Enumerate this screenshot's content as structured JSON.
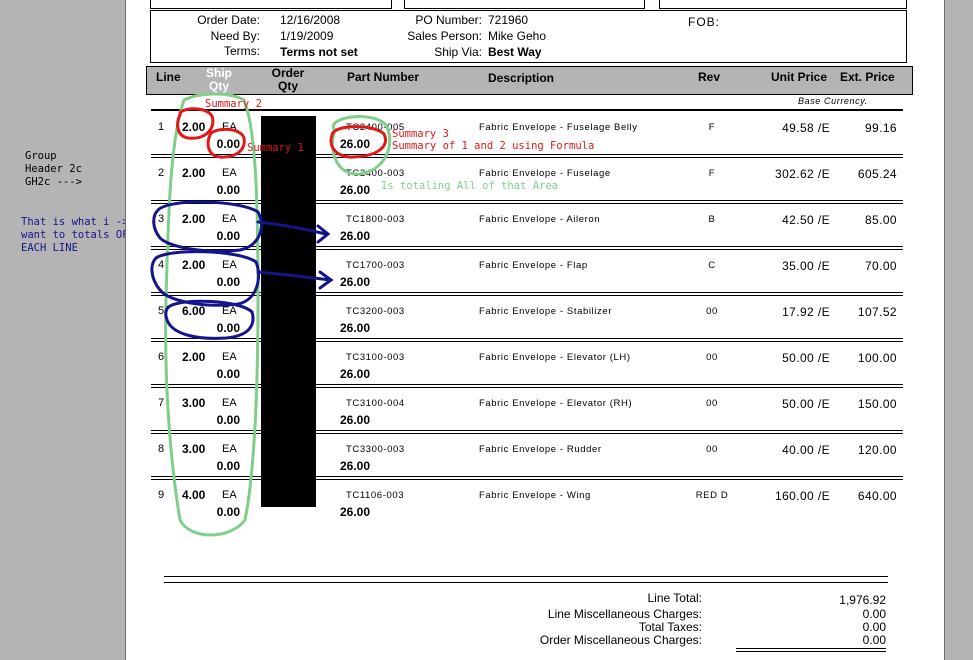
{
  "header": {
    "order_date_label": "Order Date:",
    "order_date": "12/16/2008",
    "need_by_label": "Need By:",
    "need_by": "1/19/2009",
    "terms_label": "Terms:",
    "terms": "Terms not set",
    "po_label": "PO Number:",
    "po": "721960",
    "sales_label": "Sales Person:",
    "sales": "Mike Geho",
    "shipvia_label": "Ship Via:",
    "shipvia": "Best Way",
    "fob_label": "FOB:"
  },
  "columns": {
    "line": "Line",
    "ship": "Ship",
    "ship2": "Qty",
    "order": "Order",
    "order2": "Qty",
    "part": "Part Number",
    "desc": "Description",
    "rev": "Rev",
    "unit": "Unit Price",
    "ext": "Ext. Price"
  },
  "base_currency": "Base Currency.",
  "rows": [
    {
      "line": "1",
      "ship": "2.00",
      "uom": "EA",
      "sub": "0.00",
      "part": "TC2400-005",
      "sum": "26.00",
      "desc": "Fabric Envelope - Fuselage Belly",
      "rev": "F",
      "unit": "49.58 /E",
      "ext": "99.16"
    },
    {
      "line": "2",
      "ship": "2.00",
      "uom": "EA",
      "sub": "0.00",
      "part": "TC2400-003",
      "sum": "26.00",
      "desc": "Fabric Envelope - Fuselage",
      "rev": "F",
      "unit": "302.62 /E",
      "ext": "605.24"
    },
    {
      "line": "3",
      "ship": "2.00",
      "uom": "EA",
      "sub": "0.00",
      "part": "TC1800-003",
      "sum": "26.00",
      "desc": "Fabric Envelope - Aileron",
      "rev": "B",
      "unit": "42.50 /E",
      "ext": "85.00"
    },
    {
      "line": "4",
      "ship": "2.00",
      "uom": "EA",
      "sub": "0.00",
      "part": "TC1700-003",
      "sum": "26.00",
      "desc": "Fabric Envelope - Flap",
      "rev": "C",
      "unit": "35.00 /E",
      "ext": "70.00"
    },
    {
      "line": "5",
      "ship": "6.00",
      "uom": "EA",
      "sub": "0.00",
      "part": "TC3200-003",
      "sum": "26.00",
      "desc": "Fabric Envelope - Stabilizer",
      "rev": "00",
      "unit": "17.92 /E",
      "ext": "107.52"
    },
    {
      "line": "6",
      "ship": "2.00",
      "uom": "EA",
      "sub": "0.00",
      "part": "TC3100-003",
      "sum": "26.00",
      "desc": "Fabric Envelope - Elevator (LH)",
      "rev": "00",
      "unit": "50.00 /E",
      "ext": "100.00"
    },
    {
      "line": "7",
      "ship": "3.00",
      "uom": "EA",
      "sub": "0.00",
      "part": "TC3100-004",
      "sum": "26.00",
      "desc": "Fabric Envelope - Elevator (RH)",
      "rev": "00",
      "unit": "50.00 /E",
      "ext": "150.00"
    },
    {
      "line": "8",
      "ship": "3.00",
      "uom": "EA",
      "sub": "0.00",
      "part": "TC3300-003",
      "sum": "26.00",
      "desc": "Fabric Envelope - Rudder",
      "rev": "00",
      "unit": "40.00 /E",
      "ext": "120.00"
    },
    {
      "line": "9",
      "ship": "4.00",
      "uom": "EA",
      "sub": "0.00",
      "part": "TC1106-003",
      "sum": "26.00",
      "desc": "Fabric Envelope - Wing",
      "rev": "RED D",
      "unit": "160.00 /E",
      "ext": "640.00"
    }
  ],
  "totals": {
    "line_total_label": "Line Total:",
    "line_total": "1,976.92",
    "line_misc_label": "Line Miscellaneous Charges:",
    "line_misc": "0.00",
    "taxes_label": "Total Taxes:",
    "taxes": "0.00",
    "order_misc_label": "Order Miscellaneous Charges:",
    "order_misc": "0.00"
  },
  "annotations": {
    "summary2": "Summary 2",
    "summary1": "Summary 1",
    "summary3_a": "Summary 3",
    "summary3_b": "Summary of 1 and 2 using Formula",
    "totaling": "Is totaling All of that Area",
    "group_1": "Group",
    "group_2": "Header 2c",
    "group_3": "GH2c  --->",
    "want_1": "That is what i ->",
    "want_2": "want to totals OF",
    "want_3": "EACH LINE"
  },
  "colors": {
    "red": "#e01818",
    "green": "#7fcf8a",
    "blue": "#14148c",
    "page_bg": "#b4b4b4"
  }
}
